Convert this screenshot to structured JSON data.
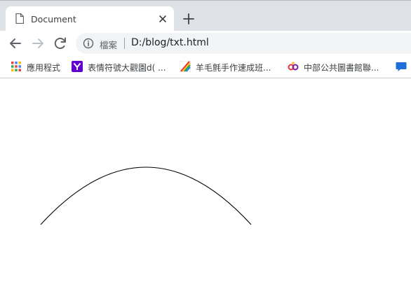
{
  "tab": {
    "title": "Document",
    "favicon": "document-icon",
    "close_icon": "close-icon"
  },
  "new_tab_icon": "plus-icon",
  "toolbar": {
    "back_icon": "back-arrow-icon",
    "forward_icon": "forward-arrow-icon",
    "reload_icon": "reload-icon",
    "security_icon": "info-icon",
    "security_label": "檔案",
    "url": "D:/blog/txt.html"
  },
  "bookmarks": [
    {
      "label": "應用程式",
      "icon": "apps-grid-icon"
    },
    {
      "label": "表情符號大觀園d( ...",
      "icon": "yahoo-icon"
    },
    {
      "label": "羊毛氈手作速成班...",
      "icon": "rainbow-icon"
    },
    {
      "label": "中部公共圖書館聯...",
      "icon": "infinity-logo-icon"
    },
    {
      "label": "",
      "icon": "chat-bubble-icon"
    }
  ],
  "colors": {
    "tabstrip_bg": "#dee1e6",
    "omnibox_bg": "#f1f3f4",
    "yahoo_purple": "#6001d2",
    "arc_stroke": "#000000"
  },
  "canvas": {
    "shape": "arc"
  }
}
